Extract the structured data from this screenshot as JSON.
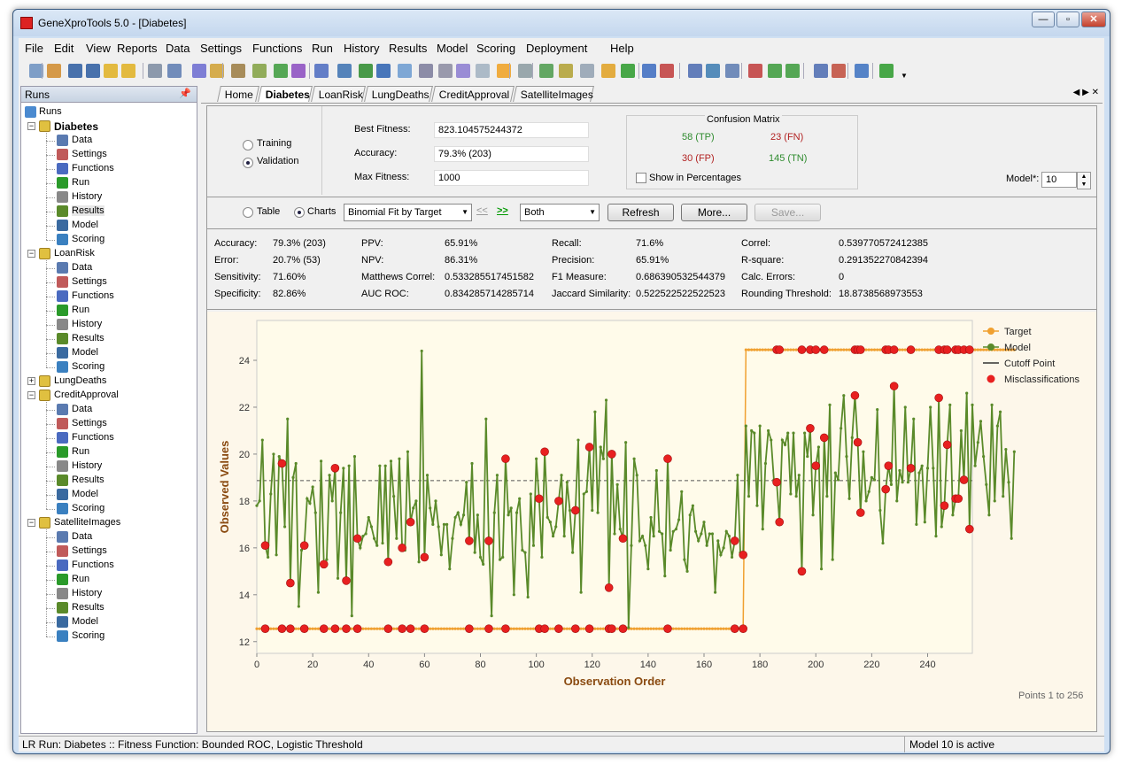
{
  "window": {
    "title": "GeneXproTools 5.0 - [Diabetes]"
  },
  "menu": [
    "File",
    "Edit",
    "View",
    "Reports",
    "Data",
    "Settings",
    "Functions",
    "Run",
    "History",
    "Results",
    "Model",
    "Scoring",
    "Deployment",
    "Help"
  ],
  "runs_panel": {
    "title": "Runs",
    "root": "Runs",
    "projects": [
      {
        "name": "Diabetes",
        "bold": true,
        "expanded": true,
        "items": [
          "Data",
          "Settings",
          "Functions",
          "Run",
          "History",
          "Results",
          "Model",
          "Scoring"
        ]
      },
      {
        "name": "LoanRisk",
        "expanded": true,
        "items": [
          "Data",
          "Settings",
          "Functions",
          "Run",
          "History",
          "Results",
          "Model",
          "Scoring"
        ]
      },
      {
        "name": "LungDeaths",
        "expanded": false,
        "items": []
      },
      {
        "name": "CreditApproval",
        "expanded": true,
        "items": [
          "Data",
          "Settings",
          "Functions",
          "Run",
          "History",
          "Results",
          "Model",
          "Scoring"
        ]
      },
      {
        "name": "SatelliteImages",
        "expanded": true,
        "items": [
          "Data",
          "Settings",
          "Functions",
          "Run",
          "History",
          "Results",
          "Model",
          "Scoring"
        ]
      }
    ]
  },
  "tabs": [
    "Home",
    "Diabetes",
    "LoanRisk",
    "LungDeaths",
    "CreditApproval",
    "SatelliteImages"
  ],
  "active_tab": "Diabetes",
  "fitness": {
    "training_label": "Training",
    "validation_label": "Validation",
    "selected": "Validation",
    "best_fitness_label": "Best Fitness:",
    "best_fitness": "823.104575244372",
    "accuracy_label": "Accuracy:",
    "accuracy": "79.3% (203)",
    "max_fitness_label": "Max Fitness:",
    "max_fitness": "1000"
  },
  "confusion": {
    "title": "Confusion Matrix",
    "tp": "58 (TP)",
    "fn": "23 (FN)",
    "fp": "30 (FP)",
    "tn": "145 (TN)",
    "show_pct_label": "Show in Percentages",
    "colors": {
      "tp": "#2e8b2e",
      "tn": "#2e8b2e",
      "fn": "#b22222",
      "fp": "#b22222"
    }
  },
  "model_selector": {
    "label": "Model*:",
    "value": "10"
  },
  "view": {
    "table_label": "Table",
    "charts_label": "Charts",
    "selected": "Charts",
    "chart_combo": "Binomial Fit by Target",
    "prev": "<<",
    "next": ">>",
    "data_combo": "Both",
    "refresh": "Refresh",
    "more": "More...",
    "save": "Save..."
  },
  "stats": [
    [
      [
        "Accuracy:",
        "79.3% (203)"
      ],
      [
        "Error:",
        "20.7% (53)"
      ],
      [
        "Sensitivity:",
        "71.60%"
      ],
      [
        "Specificity:",
        "82.86%"
      ]
    ],
    [
      [
        "PPV:",
        "65.91%"
      ],
      [
        "NPV:",
        "86.31%"
      ],
      [
        "Matthews Correl:",
        "0.533285517451582"
      ],
      [
        "AUC ROC:",
        "0.834285714285714"
      ]
    ],
    [
      [
        "Recall:",
        "71.6%"
      ],
      [
        "Precision:",
        "65.91%"
      ],
      [
        "F1 Measure:",
        "0.686390532544379"
      ],
      [
        "Jaccard Similarity:",
        "0.522522522522523"
      ]
    ],
    [
      [
        "Correl:",
        "0.539770572412385"
      ],
      [
        "R-square:",
        "0.291352270842394"
      ],
      [
        "Calc. Errors:",
        "0"
      ],
      [
        "Rounding Threshold:",
        "18.8738568973553"
      ]
    ]
  ],
  "chart_data": {
    "type": "line",
    "xlabel": "Observation Order",
    "ylabel": "Observed Values",
    "xlim": [
      0,
      256
    ],
    "ylim": [
      11.5,
      25.7
    ],
    "xticks": [
      0,
      20,
      40,
      60,
      80,
      100,
      120,
      140,
      160,
      180,
      200,
      220,
      240
    ],
    "yticks": [
      12,
      14,
      16,
      18,
      20,
      22,
      24
    ],
    "cutoff": 18.87,
    "target_low": 12.55,
    "target_high": 24.45,
    "target_switch": 175,
    "series": [
      {
        "name": "Target"
      },
      {
        "name": "Model"
      },
      {
        "name": "Cutoff Point"
      },
      {
        "name": "Misclassifications"
      }
    ],
    "colors": {
      "target": "#f0a030",
      "model": "#5a8a2a",
      "cutoff": "#555555",
      "miss": "#e82020"
    },
    "model_values": [
      17.8,
      18.0,
      20.6,
      16.1,
      15.6,
      18.3,
      20.0,
      15.7,
      19.9,
      19.6,
      16.9,
      21.5,
      14.5,
      19.0,
      19.6,
      13.5,
      15.9,
      16.1,
      18.1,
      17.9,
      18.6,
      17.5,
      14.1,
      19.7,
      15.3,
      15.5,
      19.1,
      18.0,
      19.4,
      14.7,
      17.5,
      19.4,
      14.6,
      19.5,
      13.1,
      19.9,
      16.4,
      16.0,
      16.5,
      16.6,
      17.3,
      16.9,
      16.4,
      16.1,
      19.5,
      16.2,
      19.5,
      15.4,
      19.7,
      18.2,
      16.4,
      19.8,
      16.0,
      15.9,
      20.1,
      17.1,
      17.7,
      18.0,
      15.4,
      24.4,
      15.6,
      19.1,
      17.7,
      17.0,
      18.0,
      16.9,
      15.7,
      17.0,
      17.0,
      15.1,
      16.4,
      17.3,
      17.5,
      17.0,
      17.4,
      18.8,
      16.3,
      19.6,
      15.8,
      17.4,
      15.6,
      15.3,
      21.5,
      16.3,
      13.1,
      17.5,
      19.1,
      15.5,
      15.6,
      19.8,
      17.4,
      17.7,
      14.0,
      17.5,
      18.1,
      15.9,
      15.8,
      13.9,
      18.3,
      16.1,
      19.8,
      18.1,
      15.6,
      20.1,
      17.3,
      17.1,
      16.5,
      16.9,
      18.0,
      19.1,
      16.5,
      18.8,
      17.6,
      15.8,
      17.6,
      20.6,
      14.1,
      18.3,
      18.4,
      20.3,
      17.6,
      21.8,
      17.5,
      20.3,
      19.8,
      22.3,
      14.3,
      20.0,
      16.6,
      18.7,
      16.8,
      16.4,
      20.5,
      12.6,
      16.1,
      19.8,
      19.1,
      16.3,
      16.5,
      16.1,
      15.1,
      17.3,
      16.5,
      19.3,
      16.7,
      16.6,
      14.8,
      19.8,
      15.9,
      16.7,
      16.8,
      17.2,
      18.4,
      15.5,
      15.0,
      17.4,
      17.8,
      16.7,
      16.3,
      16.6,
      17.1,
      16.1,
      16.6,
      16.6,
      14.1,
      16.3,
      15.7,
      16.0,
      16.7,
      16.5,
      15.6,
      16.3,
      19.1,
      15.8,
      15.7,
      21.2,
      18.2,
      21.0,
      20.9,
      17.8,
      21.2,
      16.8,
      19.6,
      21.0,
      20.6,
      18.9,
      18.8,
      17.1,
      20.6,
      20.4,
      20.9,
      18.3,
      20.9,
      18.2,
      19.1,
      15.0,
      20.9,
      19.9,
      21.1,
      17.4,
      19.5,
      20.3,
      15.1,
      20.7,
      18.2,
      22.1,
      15.5,
      19.2,
      18.9,
      21.1,
      22.5,
      19.9,
      18.1,
      20.7,
      22.5,
      20.5,
      17.5,
      20.1,
      18.0,
      18.4,
      19.0,
      18.9,
      21.9,
      17.6,
      16.2,
      18.5,
      19.5,
      18.7,
      22.9,
      18.0,
      19.3,
      18.8,
      22.0,
      18.8,
      19.4,
      21.5,
      17.0,
      19.2,
      19.5,
      17.1,
      19.4,
      22.0,
      19.4,
      16.5,
      22.4,
      16.9,
      17.8,
      20.4,
      22.1,
      17.4,
      18.1,
      18.1,
      21.0,
      18.9,
      22.6,
      16.8,
      22.1,
      19.5,
      20.5,
      21.4,
      19.9,
      18.7,
      17.4,
      22.1,
      18.0,
      21.2,
      21.8,
      18.2,
      20.2,
      18.8,
      16.4,
      20.1
    ],
    "miss_indices": [
      3,
      9,
      12,
      17,
      24,
      28,
      32,
      36,
      47,
      52,
      55,
      60,
      76,
      83,
      89,
      101,
      103,
      108,
      114,
      119,
      126,
      127,
      131,
      147,
      171,
      174,
      186,
      187,
      195,
      198,
      200,
      203,
      214,
      215,
      216,
      225,
      226,
      228,
      234,
      244,
      246,
      247,
      250,
      251,
      253,
      255
    ]
  },
  "legend": [
    "Target",
    "Model",
    "Cutoff Point",
    "Misclassifications"
  ],
  "points_label": "Points 1 to 256",
  "status": {
    "left": "LR Run: Diabetes :: Fitness Function: Bounded ROC, Logistic Threshold",
    "right": "Model 10 is active"
  }
}
